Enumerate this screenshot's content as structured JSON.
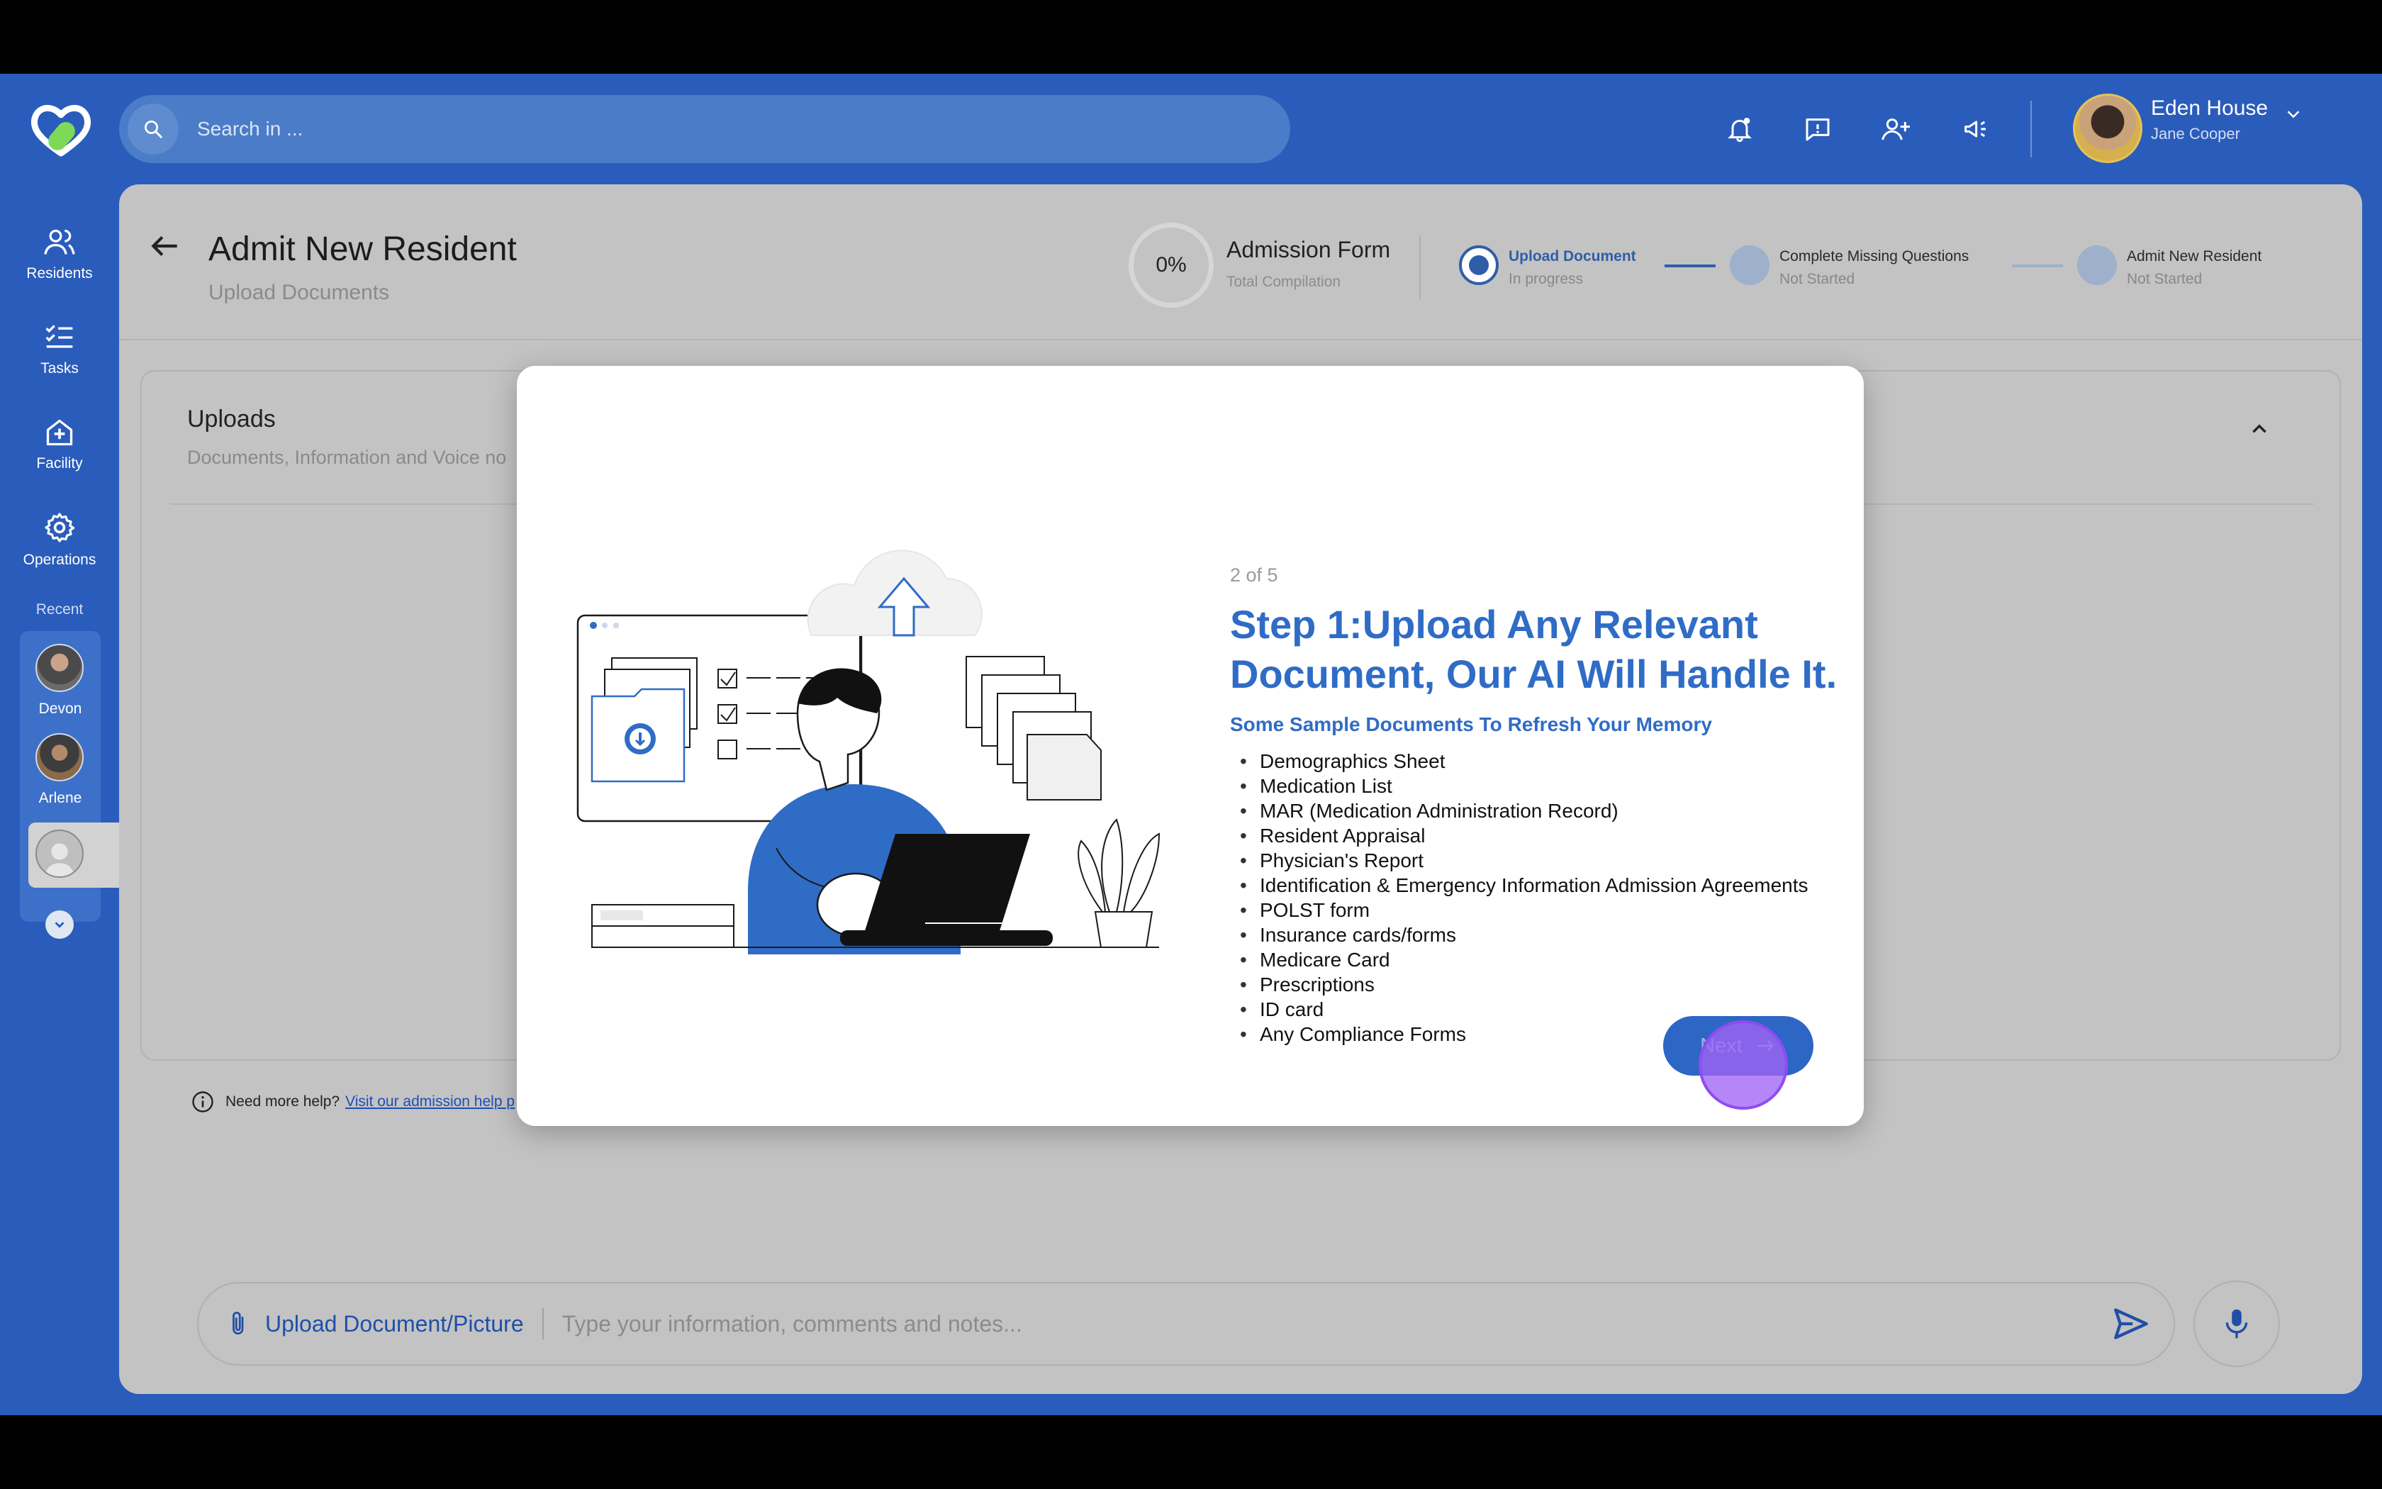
{
  "header": {
    "search_placeholder": "Search in ...",
    "user_name": "Eden House",
    "user_sub": "Jane Cooper",
    "icons": [
      "bell-icon",
      "feedback-icon",
      "add-user-icon",
      "announcement-icon"
    ]
  },
  "sidebar": {
    "items": [
      {
        "label": "Residents",
        "icon": "residents-icon"
      },
      {
        "label": "Tasks",
        "icon": "tasks-icon"
      },
      {
        "label": "Facility",
        "icon": "facility-icon"
      },
      {
        "label": "Operations",
        "icon": "gear-icon"
      }
    ],
    "recent_label": "Recent",
    "recent": [
      {
        "name": "Devon"
      },
      {
        "name": "Arlene"
      }
    ]
  },
  "page": {
    "title": "Admit New Resident",
    "subtitle": "Upload Documents",
    "progress_label": "0%",
    "progress": 0,
    "form_title": "Admission Form",
    "form_sub": "Total Compilation",
    "steps": [
      {
        "label": "Upload Document",
        "status": "In progress"
      },
      {
        "label": "Complete Missing Questions",
        "status": "Not Started"
      },
      {
        "label": "Admit New Resident",
        "status": "Not Started"
      }
    ],
    "uploads_title": "Uploads",
    "uploads_sub": "Documents, Information and Voice no",
    "help_text": "Need more help?",
    "help_link": "Visit our admission help p",
    "composer_upload": "Upload Document/Picture",
    "composer_placeholder": "Type your information, comments and notes..."
  },
  "modal": {
    "counter": "2 of 5",
    "title": "Step 1:Upload Any Relevant Document, Our AI Will Handle It.",
    "subtitle": "Some Sample Documents To Refresh Your Memory",
    "items": [
      "Demographics Sheet",
      "Medication List",
      "MAR (Medication Administration Record)",
      "Resident Appraisal",
      "Physician's Report",
      "Identification & Emergency Information Admission Agreements",
      "POLST form",
      "Insurance cards/forms",
      "Medicare Card",
      "Prescriptions",
      "ID card",
      "Any Compliance Forms"
    ],
    "next_label": "Next"
  },
  "colors": {
    "brand": "#2a5cbb",
    "accent": "#2f6cc6",
    "cursor": "#9a5cf5"
  }
}
